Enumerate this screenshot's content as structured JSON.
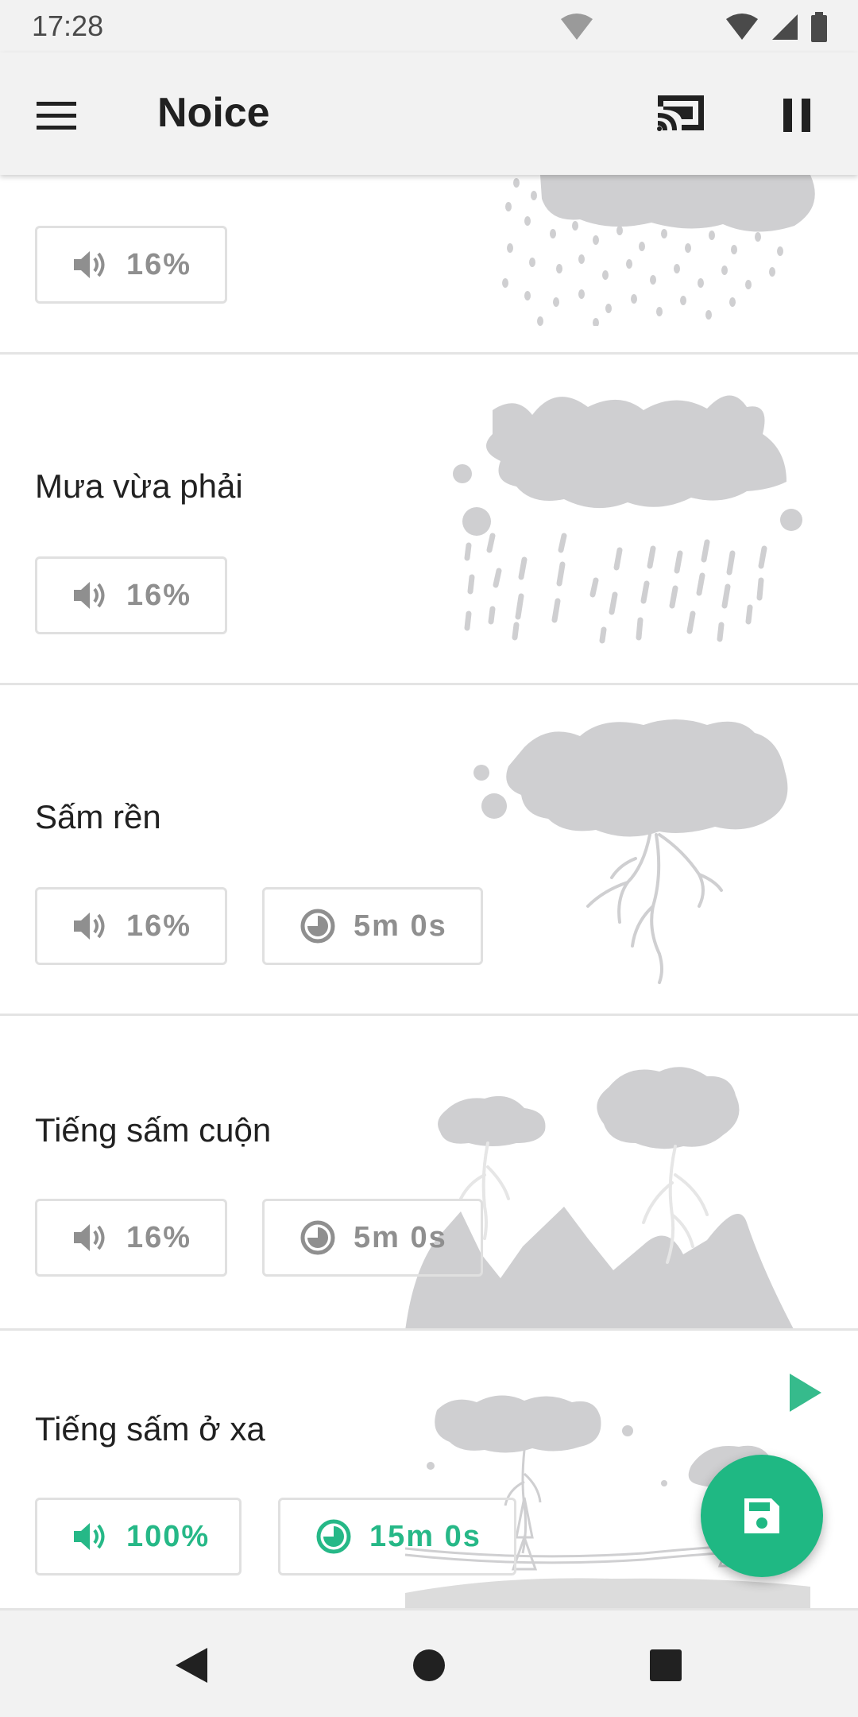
{
  "status_bar": {
    "time": "17:28"
  },
  "app_bar": {
    "title": "Noice"
  },
  "sounds": [
    {
      "name": "",
      "volume": "16%",
      "timer": null,
      "active": false
    },
    {
      "name": "Mưa vừa phải",
      "volume": "16%",
      "timer": null,
      "active": false
    },
    {
      "name": "Sấm rền",
      "volume": "16%",
      "timer": "5m 0s",
      "active": false
    },
    {
      "name": "Tiếng sấm cuộn",
      "volume": "16%",
      "timer": "5m 0s",
      "active": false
    },
    {
      "name": "Tiếng sấm ở xa",
      "volume": "100%",
      "timer": "15m 0s",
      "active": true
    }
  ],
  "icons": {
    "menu": "menu-icon",
    "cast": "cast-icon",
    "pause": "pause-icon",
    "volume": "volume-icon",
    "timer": "timer-icon",
    "play": "play-icon",
    "save": "save-icon",
    "back": "back-icon",
    "home": "home-icon",
    "recents": "recents-icon"
  },
  "colors": {
    "accent": "#1fb883",
    "chip_text": "#8f8f8f",
    "bar_bg": "#f2f2f2",
    "art": "#cfcfd1"
  }
}
